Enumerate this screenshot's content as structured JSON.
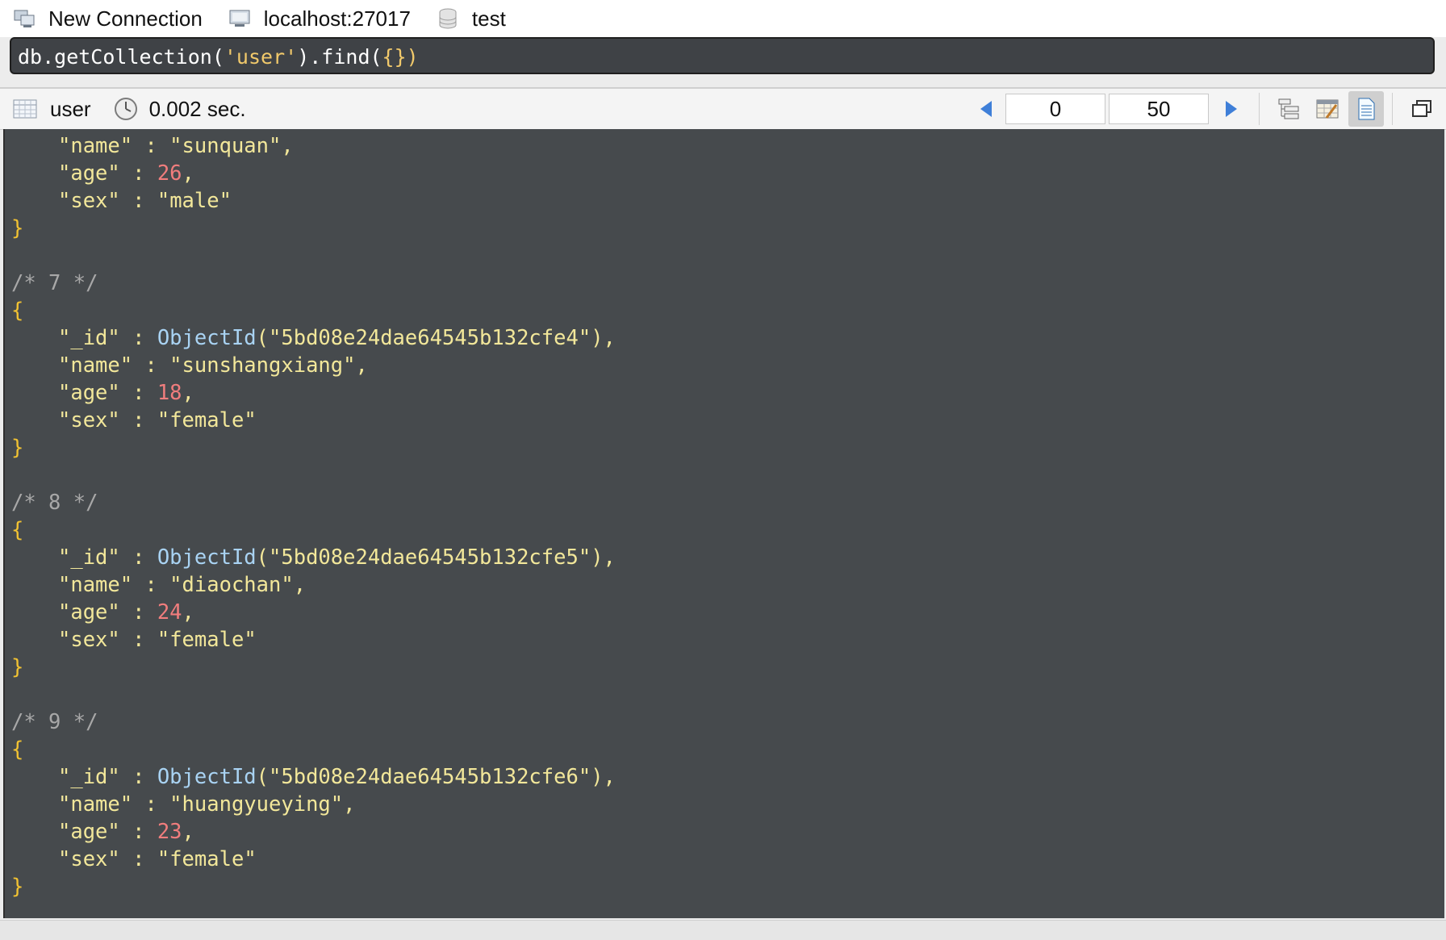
{
  "connection_bar": {
    "connection_name": "New Connection",
    "server": "localhost:27017",
    "database": "test"
  },
  "query": {
    "prefix": "db.getCollection(",
    "collection_literal": "'user'",
    "suffix_close": ").find(",
    "filter": "{}",
    "end": ")"
  },
  "result_bar": {
    "collection": "user",
    "elapsed": "0.002 sec.",
    "page_skip": "0",
    "page_limit": "50"
  },
  "results": {
    "partial_document": {
      "name": "sunquan",
      "age": "26",
      "sex": "male"
    },
    "documents": [
      {
        "comment": "/* 7 */",
        "id": "5bd08e24dae64545b132cfe4",
        "name": "sunshangxiang",
        "age": "18",
        "sex": "female"
      },
      {
        "comment": "/* 8 */",
        "id": "5bd08e24dae64545b132cfe5",
        "name": "diaochan",
        "age": "24",
        "sex": "female"
      },
      {
        "comment": "/* 9 */",
        "id": "5bd08e24dae64545b132cfe6",
        "name": "huangyueying",
        "age": "23",
        "sex": "female"
      }
    ],
    "key_id": "\"_id\"",
    "key_name": "\"name\"",
    "key_age": "\"age\"",
    "key_sex": "\"sex\"",
    "object_id_func": "ObjectId"
  },
  "colors": {
    "editor_bg": "#464a4d",
    "string": "#f2e79a",
    "number": "#f07d7d",
    "brace": "#f1c232",
    "comment": "#a8a8a8",
    "function": "#a9d3f3"
  }
}
